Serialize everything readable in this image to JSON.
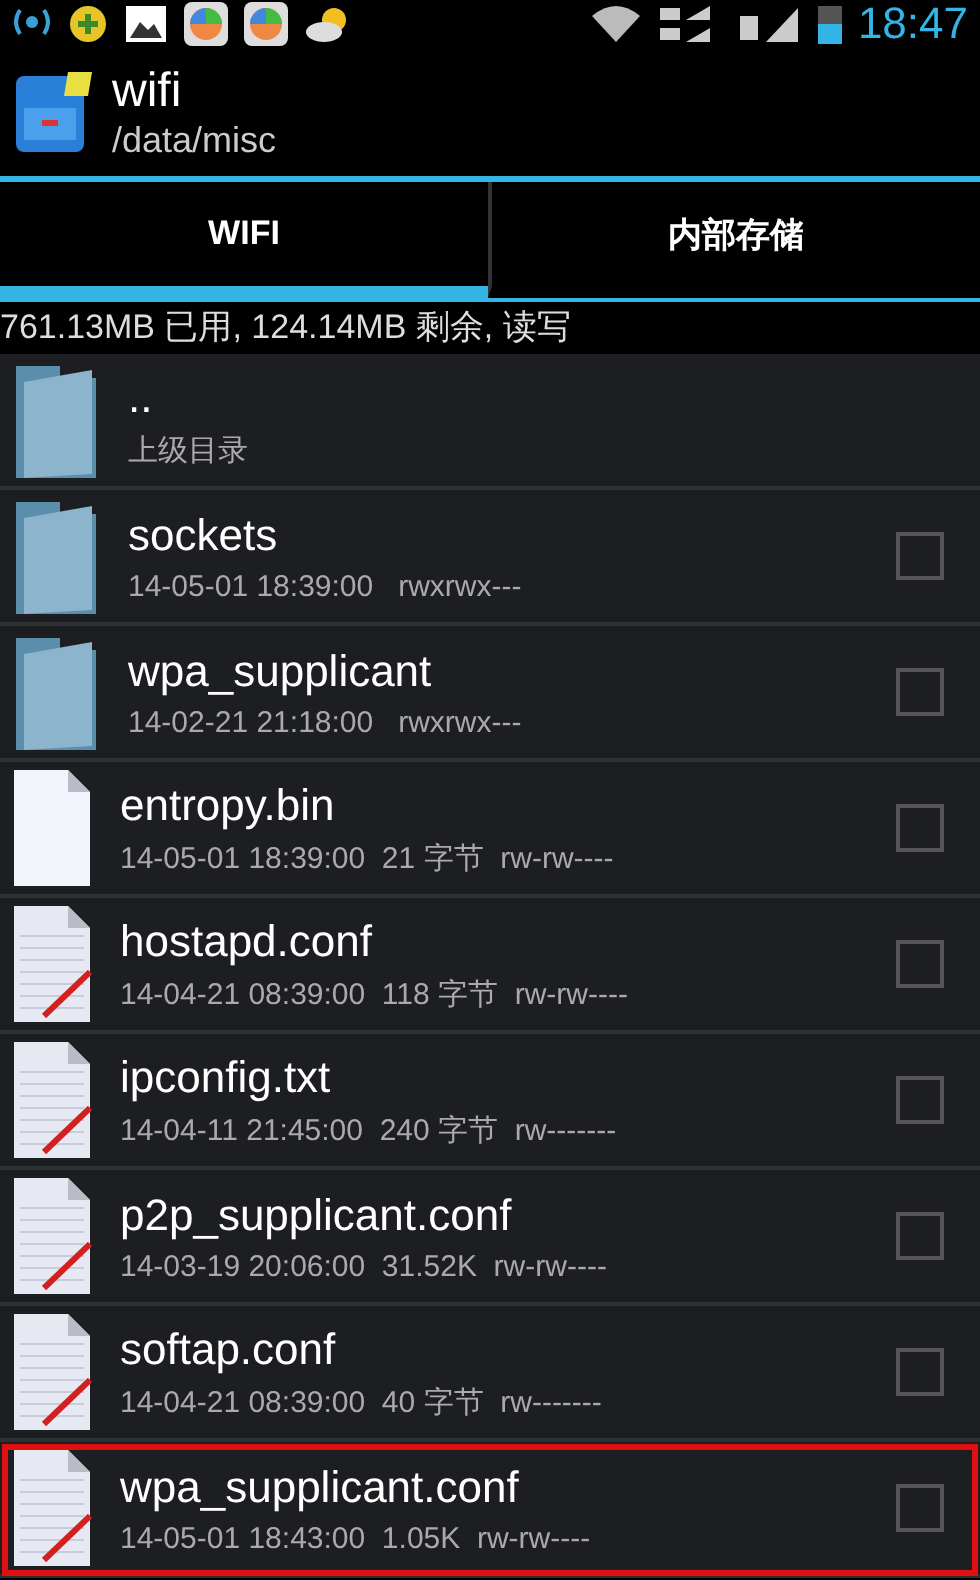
{
  "status_bar": {
    "time": "18:47"
  },
  "header": {
    "title": "wifi",
    "path": "/data/misc"
  },
  "tabs": [
    {
      "label": "WIFI",
      "selected": true
    },
    {
      "label": "内部存储",
      "selected": false
    }
  ],
  "storage_info": "761.13MB 已用, 124.14MB 剩余, 读写",
  "files": [
    {
      "kind": "folder",
      "name": "..",
      "meta": "上级目录"
    },
    {
      "kind": "folder",
      "name": "sockets",
      "meta": "14-05-01 18:39:00   rwxrwx---",
      "checked": false,
      "highlighted": false
    },
    {
      "kind": "folder",
      "name": "wpa_supplicant",
      "meta": "14-02-21 21:18:00   rwxrwx---",
      "checked": false,
      "highlighted": false
    },
    {
      "kind": "file",
      "name": "entropy.bin",
      "meta": "14-05-01 18:39:00  21 字节  rw-rw----",
      "checked": false,
      "highlighted": false
    },
    {
      "kind": "text",
      "name": "hostapd.conf",
      "meta": "14-04-21 08:39:00  118 字节  rw-rw----",
      "checked": false,
      "highlighted": false
    },
    {
      "kind": "text",
      "name": "ipconfig.txt",
      "meta": "14-04-11 21:45:00  240 字节  rw-------",
      "checked": false,
      "highlighted": false
    },
    {
      "kind": "text",
      "name": "p2p_supplicant.conf",
      "meta": "14-03-19 20:06:00  31.52K  rw-rw----",
      "checked": false,
      "highlighted": false
    },
    {
      "kind": "text",
      "name": "softap.conf",
      "meta": "14-04-21 08:39:00  40 字节  rw-------",
      "checked": false,
      "highlighted": false
    },
    {
      "kind": "text",
      "name": "wpa_supplicant.conf",
      "meta": "14-05-01 18:43:00  1.05K  rw-rw----",
      "checked": false,
      "highlighted": true
    }
  ]
}
